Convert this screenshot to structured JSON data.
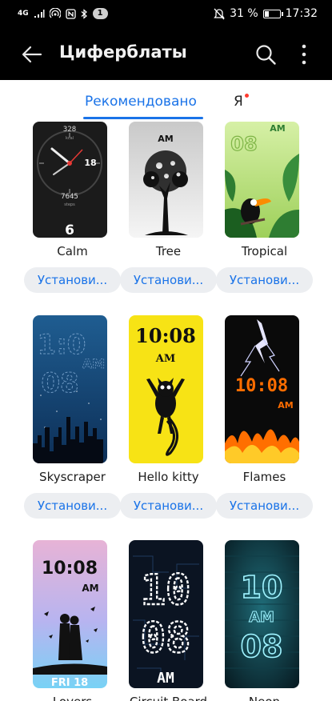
{
  "status_bar": {
    "network": "4G",
    "notification_count": "1",
    "battery_percent": "31 %",
    "battery_level": 0.31,
    "time": "17:32"
  },
  "app_bar": {
    "title": "Циферблаты",
    "back_icon": "arrow-left-icon",
    "search_icon": "search-icon",
    "menu_icon": "more-vertical-icon"
  },
  "tabs": [
    {
      "label": "Рекомендовано",
      "selected": true
    },
    {
      "label": "Я",
      "has_badge": true
    }
  ],
  "colors": {
    "accent": "#1a73e8",
    "badge": "#ff3b30"
  },
  "watchfaces": [
    {
      "name": "Calm",
      "install_label": "Установи...",
      "display": [
        "328",
        "kcal",
        "18",
        "7645",
        "steps",
        "6"
      ]
    },
    {
      "name": "Tree",
      "install_label": "Установи...",
      "display": [
        "AM"
      ]
    },
    {
      "name": "Tropical",
      "install_label": "Установи...",
      "display": [
        "AM",
        "08"
      ]
    },
    {
      "name": "Skyscraper",
      "install_label": "Установи...",
      "display": [
        "1:0",
        "AM",
        "08"
      ]
    },
    {
      "name": "Hello kitty",
      "install_label": "Установи...",
      "display": [
        "10:08",
        "AM"
      ]
    },
    {
      "name": "Flames",
      "install_label": "Установи...",
      "display": [
        "10:08",
        "AM"
      ]
    },
    {
      "name": "Lovers",
      "install_label": "",
      "display": [
        "10:08",
        "AM",
        "FRI 18"
      ]
    },
    {
      "name": "Circuit Board",
      "install_label": "",
      "display": [
        "10",
        "08",
        "AM"
      ]
    },
    {
      "name": "Neon",
      "install_label": "",
      "display": [
        "10",
        "AM",
        "08"
      ]
    }
  ]
}
